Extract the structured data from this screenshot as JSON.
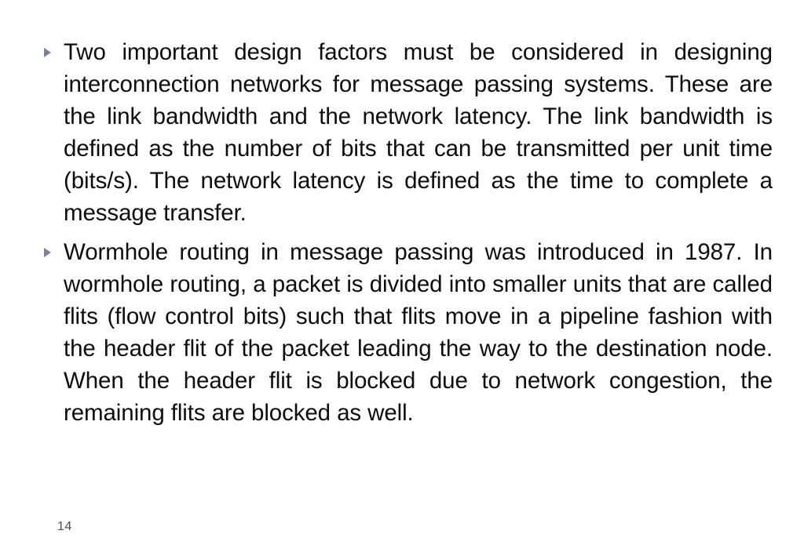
{
  "slide": {
    "background_color": "#ffffff",
    "text_color": "#0d0d0d",
    "bullet_color": "#7b7f9e",
    "page_number_color": "#4a4a4a",
    "page_number": "14"
  },
  "content": {
    "bullets": [
      {
        "marker": "triangle-right-bullet",
        "text": "Two important design factors must be considered in designing interconnection networks for message passing systems. These are the link bandwidth and the network latency. The link bandwidth is defined as the number of bits that can be transmitted per unit time (bits/s). The network latency is defined as the time to complete a message transfer."
      },
      {
        "marker": "triangle-right-bullet",
        "text": "Wormhole routing in message passing was introduced in 1987. In wormhole routing, a packet is divided into smaller units that are called flits (flow control bits) such that flits move in a pipeline fashion with the header flit of the packet leading the way to the destination node. When the header flit is blocked due to network congestion, the remaining flits are blocked as well."
      }
    ]
  }
}
